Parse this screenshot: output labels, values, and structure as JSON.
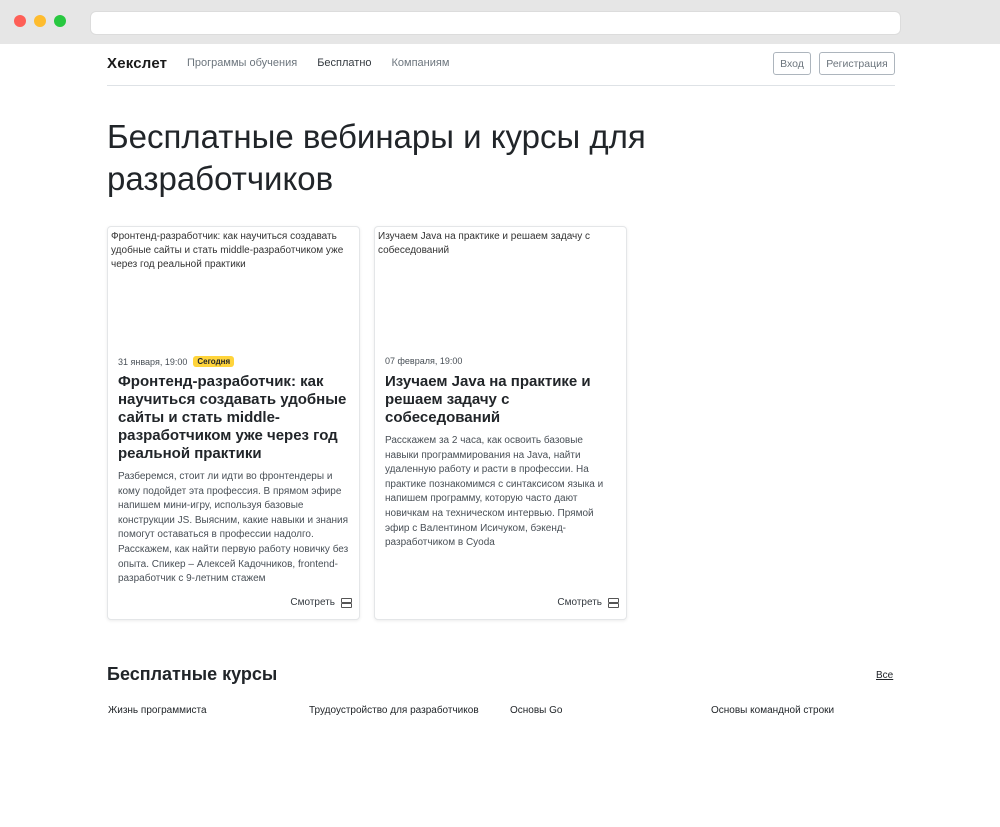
{
  "header": {
    "logo": "Хекслет",
    "nav": [
      "Программы обучения",
      "Бесплатно",
      "Компаниям"
    ],
    "login": "Вход",
    "register": "Регистрация"
  },
  "page_title": "Бесплатные вебинары и курсы для разработчиков",
  "webinars": [
    {
      "image_alt": "Фронтенд-разработчик: как научиться создавать удобные сайты и стать middle-разработчиком уже через год реальной практики",
      "date": "31 января, 19:00",
      "badge": "Сегодня",
      "title": "Фронтенд-разработчик: как научиться создавать удобные сайты и стать middle-разработчиком уже через год реальной практики",
      "description": "Разберемся, стоит ли идти во фронтендеры и кому подойдет эта профессия. В прямом эфире напишем мини-игру, используя базовые конструкции JS. Выясним, какие навыки и знания помогут оставаться в профессии надолго. Расскажем, как найти первую работу новичку без опыта. Спикер – Алексей Кадочников, frontend-разработчик с 9-летним стажем",
      "watch": "Смотреть"
    },
    {
      "image_alt": "Изучаем Java на практике и решаем задачу с собеседований",
      "date": "07 февраля, 19:00",
      "badge": "",
      "title": "Изучаем Java на практике и решаем задачу с собеседований",
      "description": "Расскажем за 2 часа, как освоить базовые навыки программирования на Java, найти удаленную работу и расти в профессии. На практике познакомимся с синтаксисом языка и напишем программу, которую часто дают новичкам на техническом интервью. Прямой эфир с Валентином Исичуком, бэкенд-разработчиком в Cyoda",
      "watch": "Смотреть"
    }
  ],
  "free_courses": {
    "title": "Бесплатные курсы",
    "all_link": "Все",
    "items": [
      "Жизнь программиста",
      "Трудоустройство для разработчиков",
      "Основы Go",
      "Основы командной строки"
    ]
  }
}
